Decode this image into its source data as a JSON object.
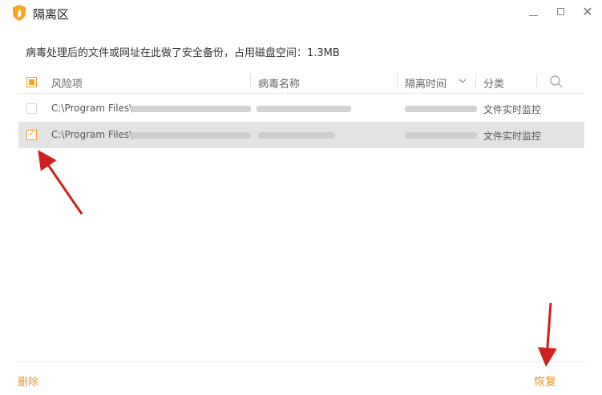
{
  "window": {
    "title": "隔离区",
    "controls": {
      "minimize": "minimize-icon",
      "maximize": "maximize-icon",
      "close": "close-icon"
    }
  },
  "info_text": "病毒处理后的文件或网址在此做了安全备份，占用磁盘空间：1.3MB",
  "table": {
    "columns": [
      "风险项",
      "病毒名称",
      "隔离时间",
      "分类"
    ],
    "rows": [
      {
        "checked": false,
        "path": "C:\\Program Files\\",
        "category": "文件实时监控"
      },
      {
        "checked": true,
        "path": "C:\\Program Files\\",
        "category": "文件实时监控"
      }
    ]
  },
  "footer": {
    "delete_label": "删除",
    "restore_label": "恢复"
  },
  "colors": {
    "accent": "#f5a623",
    "link": "#e8962a",
    "selected_row": "#e3e3e3",
    "annotation_arrow": "#d0201e"
  }
}
